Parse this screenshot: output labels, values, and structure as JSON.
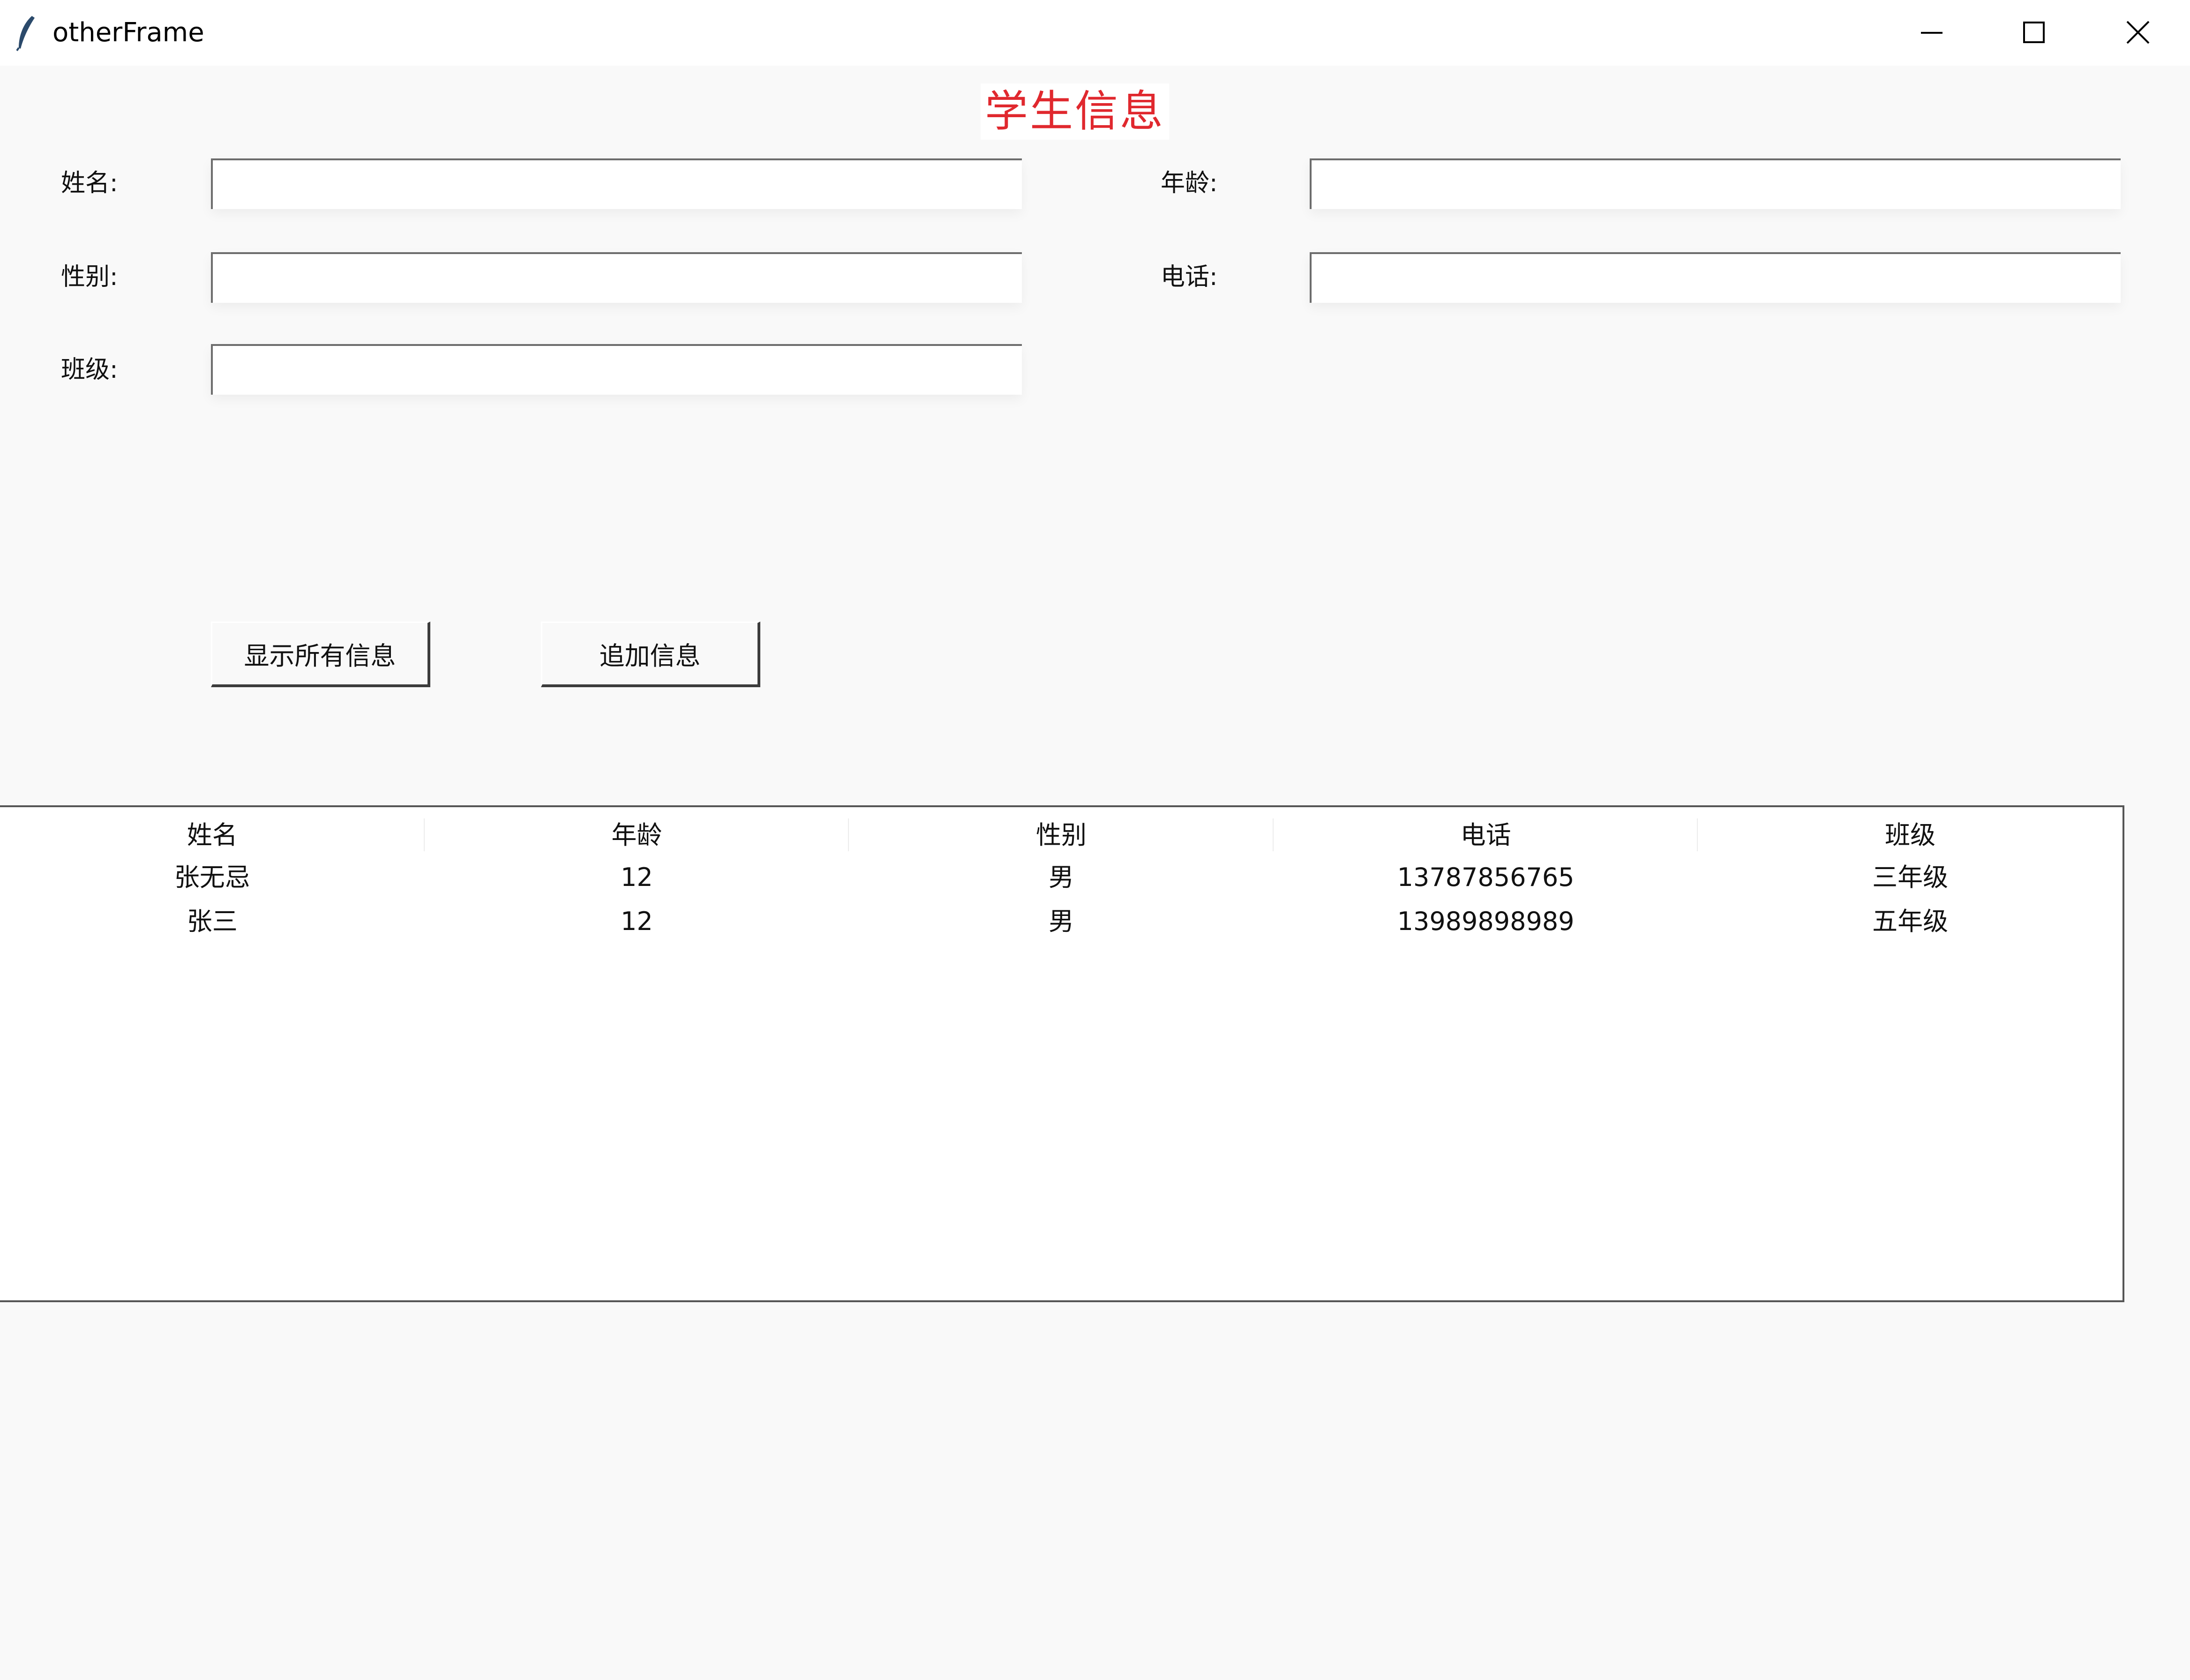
{
  "window": {
    "title": "otherFrame"
  },
  "heading": "学生信息",
  "form": {
    "name_label": "姓名:",
    "age_label": "年龄:",
    "gender_label": "性别:",
    "phone_label": "电话:",
    "class_label": "班级:",
    "name_value": "",
    "age_value": "",
    "gender_value": "",
    "phone_value": "",
    "class_value": ""
  },
  "buttons": {
    "show_all": "显示所有信息",
    "add_info": "追加信息"
  },
  "table": {
    "columns": [
      "姓名",
      "年龄",
      "性别",
      "电话",
      "班级"
    ],
    "rows": [
      [
        "张无忌",
        "12",
        "男",
        "13787856765",
        "三年级"
      ],
      [
        "张三",
        "12",
        "男",
        "13989898989",
        "五年级"
      ]
    ]
  },
  "icons": {
    "app": "feather-icon",
    "minimize": "minimize-icon",
    "maximize": "maximize-icon",
    "close": "close-icon"
  },
  "colors": {
    "heading": "#e0282e",
    "background": "#f9f9f9",
    "titlebar": "#ffffff"
  }
}
